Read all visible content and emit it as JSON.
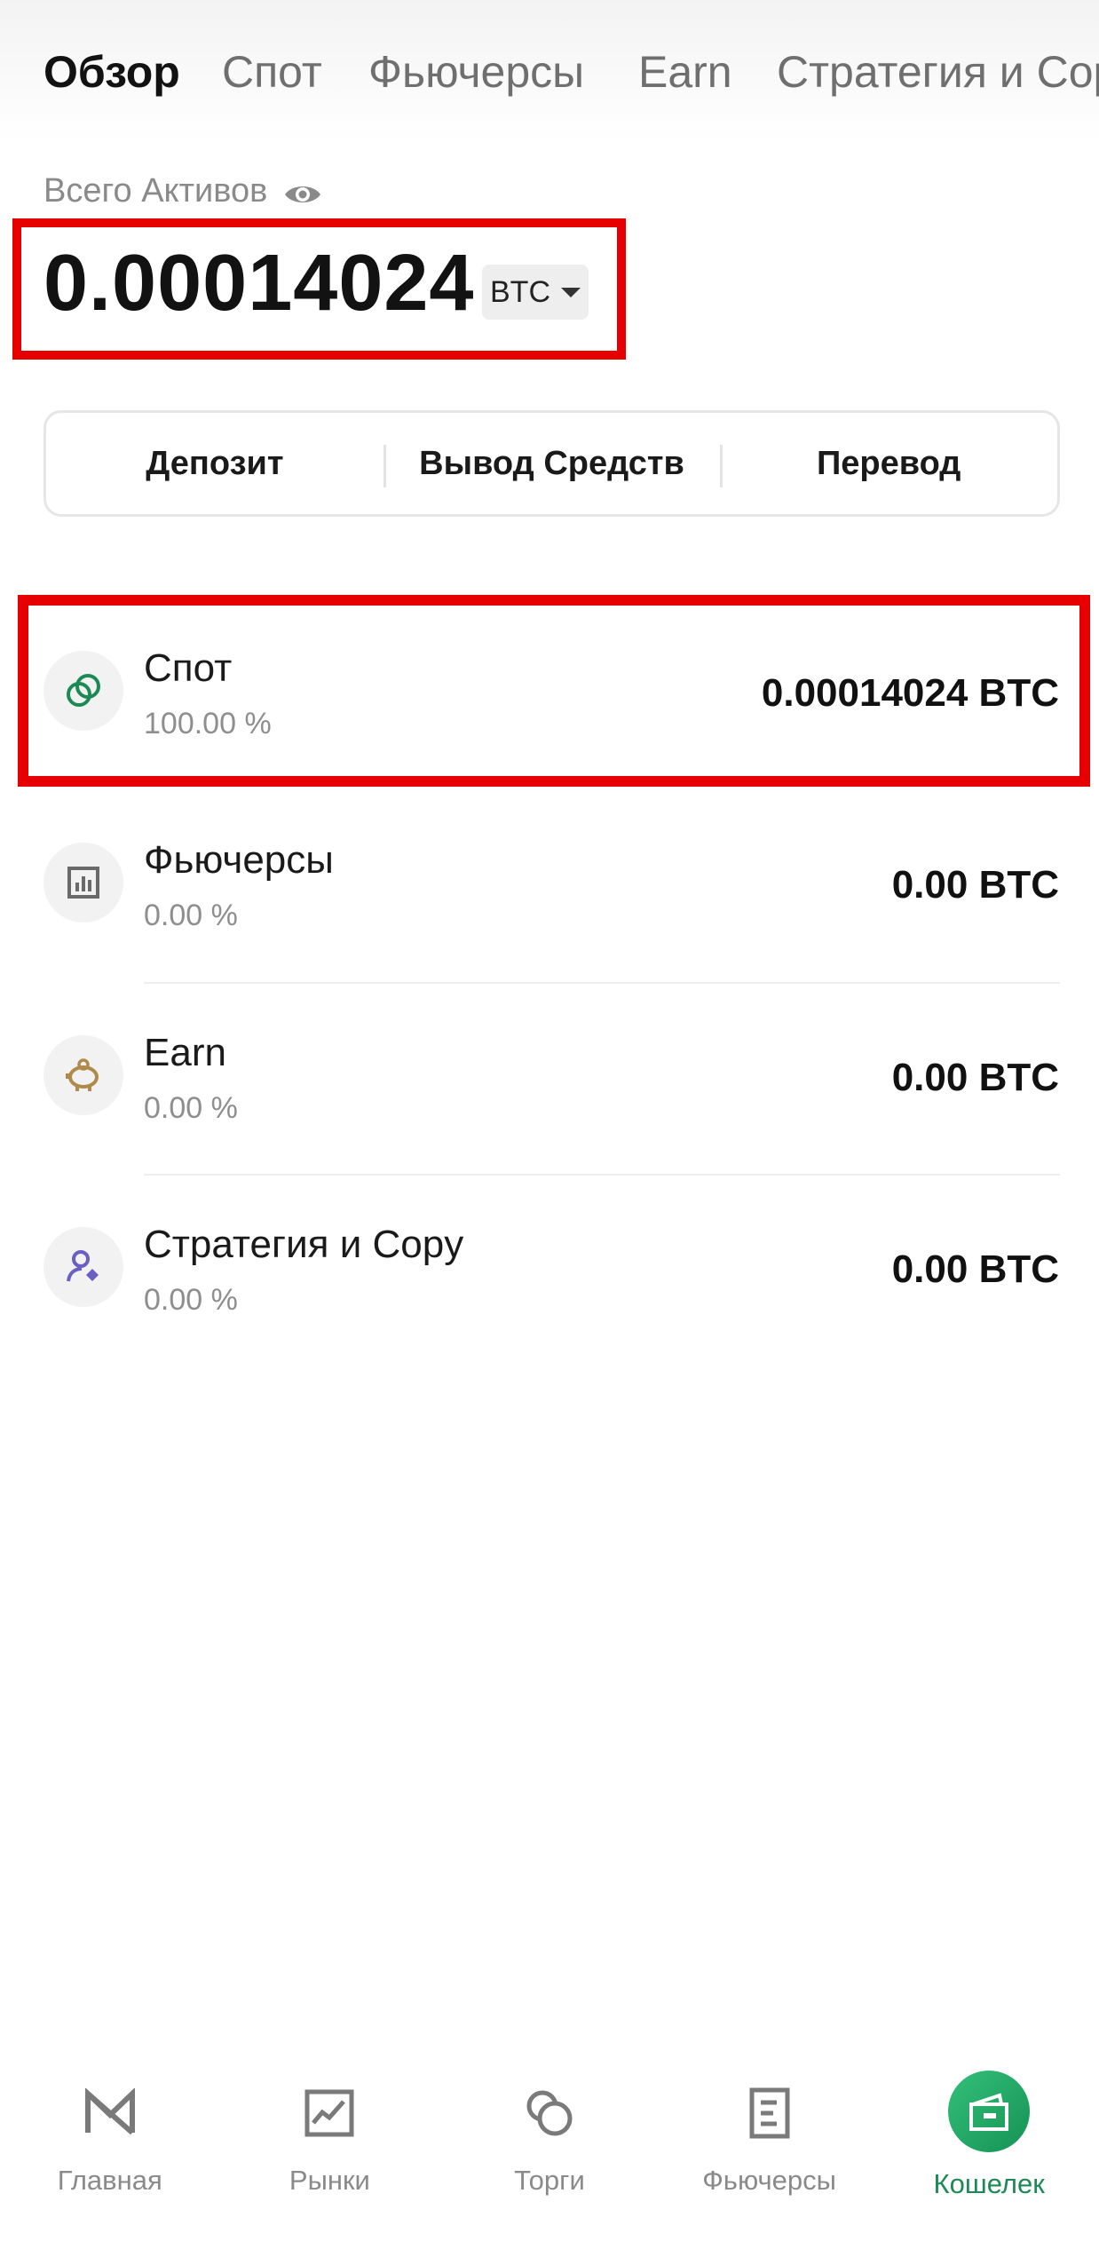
{
  "tabs": [
    {
      "label": "Обзор",
      "active": true
    },
    {
      "label": "Спот",
      "active": false
    },
    {
      "label": "Фьючерсы",
      "active": false
    },
    {
      "label": "Earn",
      "active": false
    },
    {
      "label": "Стратегия и Copy",
      "active": false
    }
  ],
  "total": {
    "label": "Всего Активов",
    "value": "0.00014024",
    "currency": "BTC"
  },
  "actions": {
    "deposit": "Депозит",
    "withdraw": "Вывод Средств",
    "transfer": "Перевод"
  },
  "accounts": [
    {
      "name": "Спот",
      "percent": "100.00 %",
      "value": "0.00014024 BTC",
      "icon": "spot-coins-icon",
      "color": "#1c8a55"
    },
    {
      "name": "Фьючерсы",
      "percent": "0.00 %",
      "value": "0.00 BTC",
      "icon": "futures-chart-icon",
      "color": "#6a6a6a"
    },
    {
      "name": "Earn",
      "percent": "0.00 %",
      "value": "0.00 BTC",
      "icon": "piggy-bank-icon",
      "color": "#b08a4a"
    },
    {
      "name": "Стратегия и Copy",
      "percent": "0.00 %",
      "value": "0.00 BTC",
      "icon": "copy-trader-icon",
      "color": "#6a5fc2"
    }
  ],
  "bottom_nav": [
    {
      "label": "Главная",
      "icon": "home-logo-icon",
      "active": false
    },
    {
      "label": "Рынки",
      "icon": "markets-chart-icon",
      "active": false
    },
    {
      "label": "Торги",
      "icon": "trade-circles-icon",
      "active": false
    },
    {
      "label": "Фьючерсы",
      "icon": "futures-doc-icon",
      "active": false
    },
    {
      "label": "Кошелек",
      "icon": "wallet-icon",
      "active": true
    }
  ],
  "colors": {
    "highlight": "#e60000",
    "accent_green": "#1c8a55"
  }
}
